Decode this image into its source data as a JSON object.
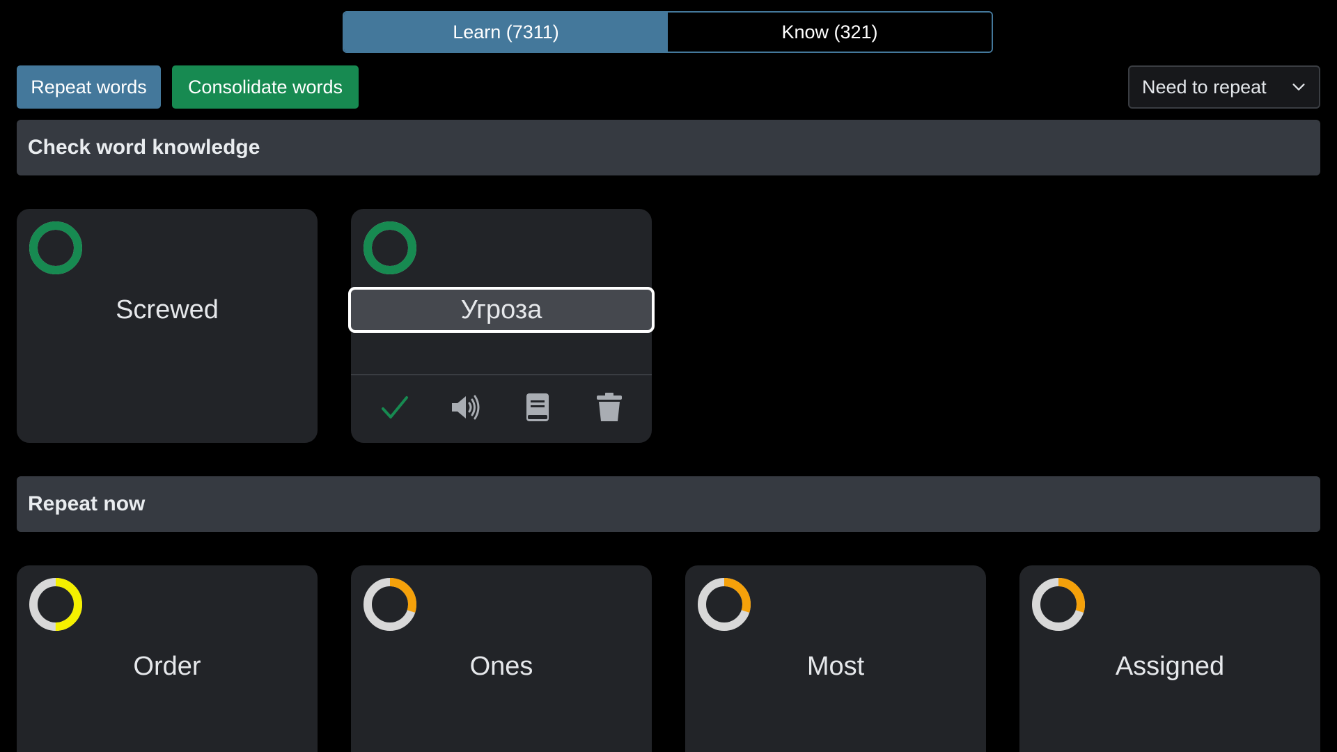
{
  "mode_toggle": {
    "learn_label": "Learn (7311)",
    "know_label": "Know (321)"
  },
  "toolbar": {
    "repeat_label": "Repeat words",
    "consolidate_label": "Consolidate words",
    "filter_selected": "Need to repeat"
  },
  "sections": {
    "check": {
      "title": "Check word knowledge",
      "cards": [
        {
          "word": "Screwed",
          "progress": 1.0,
          "ring_color": "#178a51"
        },
        {
          "word": "Угроза",
          "progress": 1.0,
          "ring_color": "#178a51",
          "selected": true
        }
      ]
    },
    "repeat": {
      "title": "Repeat now",
      "cards": [
        {
          "word": "Order",
          "progress": 0.5,
          "ring_color": "#f5f000"
        },
        {
          "word": "Ones",
          "progress": 0.3,
          "ring_color": "#f5a10a"
        },
        {
          "word": "Most",
          "progress": 0.3,
          "ring_color": "#f5a10a"
        },
        {
          "word": "Assigned",
          "progress": 0.3,
          "ring_color": "#f5a10a"
        }
      ]
    }
  },
  "card_actions": {
    "icons": [
      "check-icon",
      "speaker-icon",
      "book-icon",
      "trash-icon"
    ]
  },
  "colors": {
    "primary": "#44789b",
    "success": "#178a51",
    "header_bg": "#363a41",
    "card_bg": "#222428",
    "ring_track": "#d8d8d8"
  }
}
